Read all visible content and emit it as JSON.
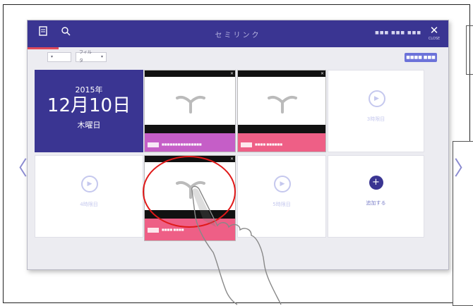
{
  "app": {
    "title": "セミリンク",
    "status": "■■■ ■■■ ■■■",
    "close_icon": "close-icon",
    "close_label": "CLOSE"
  },
  "colors": {
    "brand": "#3a3592",
    "accent": "#e04a5a",
    "pink_bar": "#ee5f86",
    "purple_bar": "#c55ec7"
  },
  "filters": {
    "select1": {
      "value": "▾",
      "arrow": "▾"
    },
    "select2": {
      "value": "フィルタ",
      "arrow": "▾"
    },
    "action_button": "■■■■ ■■■"
  },
  "date": {
    "year": "2015年",
    "month_day": "12月10日",
    "weekday": "木曜日"
  },
  "tiles": [
    {
      "caption": "■■■■■■■■■■■■■■■"
    },
    {
      "caption": "■■■■  ■■■■■■"
    },
    {
      "label": "3時限目"
    },
    {
      "label": "4時限目"
    },
    {
      "caption": "■■■■  ■■■■"
    },
    {
      "label": "5時限目"
    },
    {
      "label": "追加する"
    }
  ],
  "nav": {
    "prev": "〈",
    "next": "〉"
  }
}
